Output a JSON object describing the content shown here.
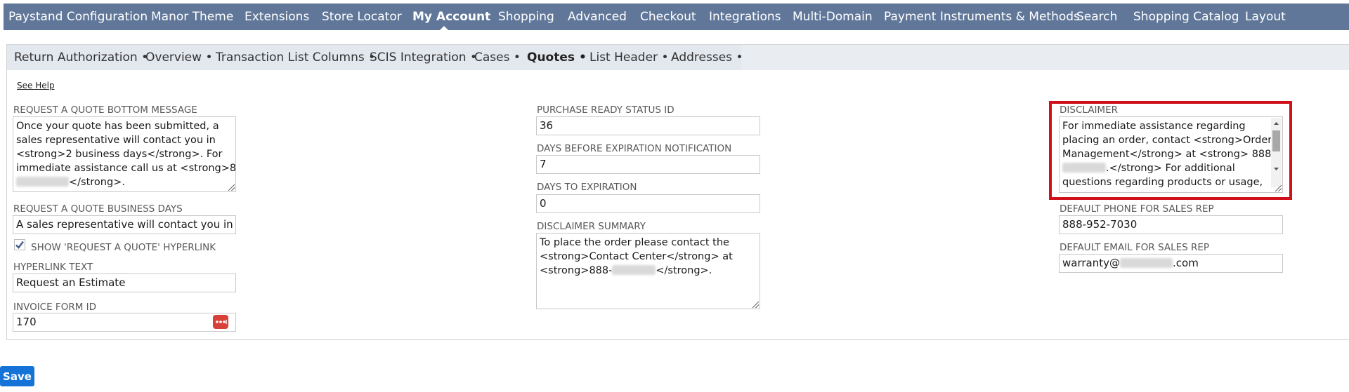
{
  "top_nav": {
    "items": [
      "Paystand Configuration",
      "Manor Theme",
      "Extensions",
      "Store Locator",
      "My Account",
      "Shopping",
      "Advanced",
      "Checkout",
      "Integrations",
      "Multi-Domain",
      "Payment Instruments & Methods",
      "Search",
      "Shopping Catalog",
      "Layout"
    ],
    "active": "My Account"
  },
  "sub_tabs": {
    "items": [
      "Return Authorization",
      "Overview",
      "Transaction List Columns",
      "SCIS Integration",
      "Cases",
      "Quotes",
      "List Header",
      "Addresses"
    ],
    "active": "Quotes",
    "separator": "•"
  },
  "see_help": "See Help",
  "col1": {
    "bottom_message_label": "REQUEST A QUOTE BOTTOM MESSAGE",
    "bottom_message_lines": [
      "Once your quote has been submitted, a",
      "sales representative will contact you in",
      "<strong>2 business days</strong>. For",
      "immediate assistance call us at <strong>888-"
    ],
    "bottom_message_last_suffix": "</strong>.",
    "business_days_label": "REQUEST A QUOTE BUSINESS DAYS",
    "business_days_value": "A sales representative will contact you in <str",
    "show_hyperlink_label": "SHOW 'REQUEST A QUOTE' HYPERLINK",
    "show_hyperlink_checked": true,
    "hyperlink_text_label": "HYPERLINK TEXT",
    "hyperlink_text_value": "Request an Estimate",
    "invoice_form_label": "INVOICE FORM ID",
    "invoice_form_value": "170"
  },
  "col2": {
    "purchase_ready_label": "PURCHASE READY STATUS ID",
    "purchase_ready_value": "36",
    "days_before_label": "DAYS BEFORE EXPIRATION NOTIFICATION",
    "days_before_value": "7",
    "days_to_label": "DAYS TO EXPIRATION",
    "days_to_value": "0",
    "summary_label": "DISCLAIMER SUMMARY",
    "summary_lines": [
      "To place the order please contact the",
      "<strong>Contact Center</strong> at"
    ],
    "summary_last_prefix": "<strong>888-",
    "summary_last_suffix": "</strong>."
  },
  "col3": {
    "disclaimer_label": "DISCLAIMER",
    "disclaimer_lines": [
      "For immediate assistance regarding",
      "placing an order, contact <strong>Order",
      "Management</strong> at <strong> 888-"
    ],
    "disclaimer_line4_suffix": ".</strong> For additional",
    "disclaimer_line5": "questions regarding products or usage,",
    "phone_label": "DEFAULT PHONE FOR SALES REP",
    "phone_value": "888-952-7030",
    "email_label": "DEFAULT EMAIL FOR SALES REP",
    "email_prefix": "warranty@",
    "email_suffix": ".com"
  },
  "save_label": "Save",
  "colors": {
    "nav_bg": "#607799",
    "subtab_bg": "#e3e7ee",
    "save_bg": "#1573d8",
    "highlight": "#d0111b",
    "dots_btn": "#d8413a"
  }
}
